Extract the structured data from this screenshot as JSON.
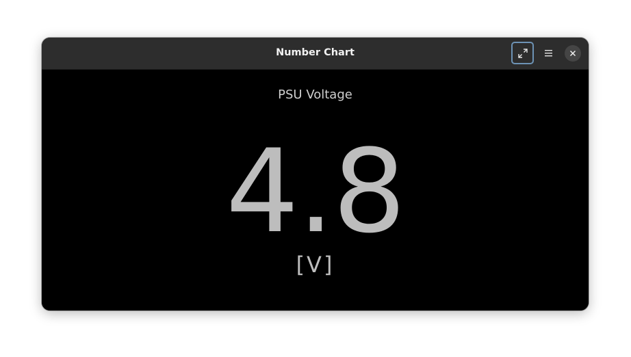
{
  "window": {
    "title": "Number Chart"
  },
  "toolbar": {
    "expand_icon": "expand-icon",
    "menu_icon": "hamburger-menu-icon",
    "close_icon": "close-icon"
  },
  "metric": {
    "title": "PSU Voltage",
    "value": "4.8",
    "unit": "[V]"
  },
  "colors": {
    "background": "#000000",
    "titlebar": "#2d2d2d",
    "value_text": "#bdbdbd",
    "focus_ring": "#6d93b5"
  }
}
